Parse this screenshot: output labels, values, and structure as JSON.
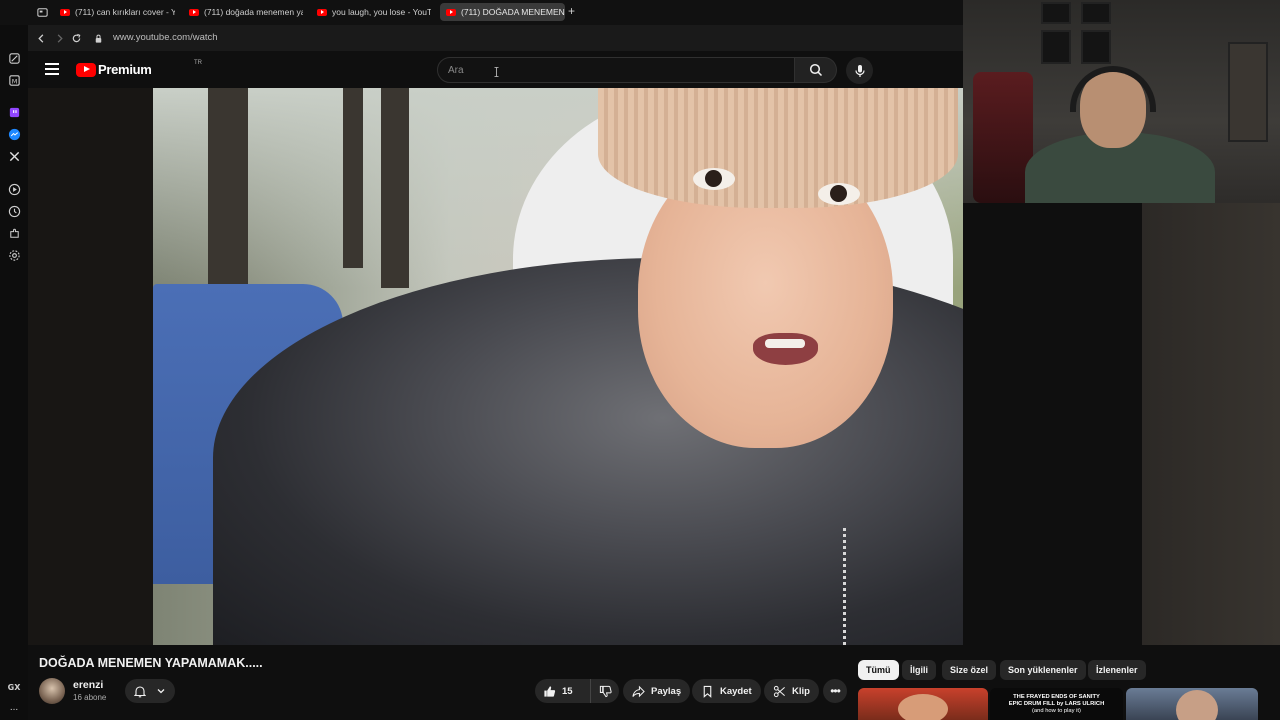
{
  "browser": {
    "tabs": [
      {
        "label": "(711) can kırıkları cover - Y"
      },
      {
        "label": "(711) doğada menemen ya"
      },
      {
        "label": "you laugh, you lose - YouT"
      },
      {
        "label": "(711) DOĞADA MENEMEN"
      }
    ],
    "url": "www.youtube.com/watch",
    "rail_bottom_label": "GX",
    "rail_more": "..."
  },
  "youtube": {
    "logo_text": "Premium",
    "logo_country": "TR",
    "search_placeholder": "Ara",
    "video_title": "DOĞADA MENEMEN YAPAMAMAK.....",
    "channel_name": "erenzi",
    "subscribers": "16 abone",
    "like_count": "15",
    "share_label": "Paylaş",
    "save_label": "Kaydet",
    "clip_label": "Klip",
    "more_label": "•••",
    "chips": [
      "Tümü",
      "İlgili",
      "Size özel",
      "Son yüklenenler",
      "İzlenenler"
    ]
  },
  "recommendations": {
    "thumb2_lines": [
      "THE FRAYED ENDS OF SANITY",
      "EPIC DRUM FILL by LARS ULRICH",
      "(and how to play it)"
    ]
  },
  "colors": {
    "youtube_red": "#ff0000",
    "background": "#0f0f0f",
    "chip_active": "#f1f1f1"
  }
}
